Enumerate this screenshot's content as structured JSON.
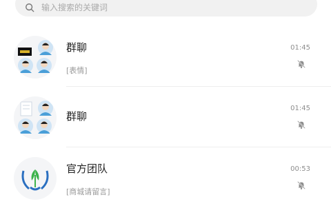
{
  "search": {
    "placeholder": "输入搜索的关键词"
  },
  "conversations": [
    {
      "name": "群聊",
      "preview": "[表情]",
      "time": "01:45",
      "muted": true,
      "avatar_icon": "group-avatar-icon"
    },
    {
      "name": "群聊",
      "preview": "",
      "time": "01:45",
      "muted": true,
      "avatar_icon": "group-avatar-icon"
    },
    {
      "name": "官方团队",
      "preview": "[商城请留言]",
      "time": "00:53",
      "muted": true,
      "avatar_icon": "official-team-logo-icon"
    }
  ],
  "colors": {
    "accent": "#4a9fd8",
    "logo_green": "#3bb34a",
    "logo_blue": "#2a6fc0"
  }
}
